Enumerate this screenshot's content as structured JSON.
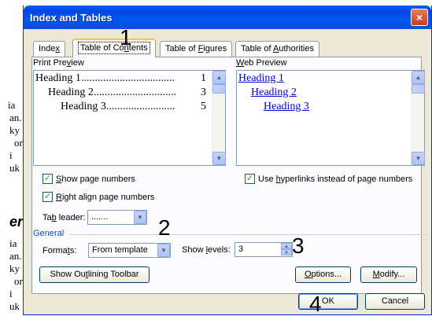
{
  "dialog": {
    "title": "Index and Tables",
    "close_icon": "×"
  },
  "tabs": [
    {
      "pre": "Inde",
      "accel": "x",
      "post": ""
    },
    {
      "pre": "Table of Co",
      "accel": "n",
      "post": "tents"
    },
    {
      "pre": "Table of ",
      "accel": "F",
      "post": "igures"
    },
    {
      "pre": "Table of ",
      "accel": "A",
      "post": "uthorities"
    }
  ],
  "print_preview": {
    "label_pre": "Print Pre",
    "label_accel": "v",
    "label_post": "iew",
    "lines": [
      {
        "text": "Heading 1",
        "dots": "..................................",
        "page": "1"
      },
      {
        "text": "Heading 2",
        "dots": "..............................",
        "page": "3"
      },
      {
        "text": "Heading 3",
        "dots": ".........................",
        "page": "5"
      }
    ]
  },
  "web_preview": {
    "label_pre": "",
    "label_accel": "W",
    "label_post": "eb Preview",
    "links": [
      "Heading 1",
      "Heading 2",
      "Heading 3"
    ]
  },
  "options": {
    "show_page_numbers": {
      "pre": "",
      "accel": "S",
      "post": "how page numbers",
      "checked": true
    },
    "right_align": {
      "pre": "",
      "accel": "R",
      "post": "ight align page numbers",
      "checked": true
    },
    "use_hyperlinks": {
      "pre": "Use ",
      "accel": "h",
      "post": "yperlinks instead of page numbers",
      "checked": true
    },
    "tab_leader": {
      "pre": "Ta",
      "accel": "b",
      "post": " leader:",
      "value": "......."
    }
  },
  "general": {
    "title": "General",
    "formats": {
      "pre": "Forma",
      "accel": "t",
      "post": "s:",
      "value": "From template"
    },
    "show_levels": {
      "pre": "Show ",
      "accel": "l",
      "post": "evels:",
      "value": "3"
    }
  },
  "buttons": {
    "outlining": {
      "pre": "Show Ou",
      "accel": "t",
      "post": "lining Toolbar"
    },
    "options": {
      "pre": "",
      "accel": "O",
      "post": "ptions..."
    },
    "modify": {
      "pre": "",
      "accel": "M",
      "post": "odify..."
    },
    "ok": "OK",
    "cancel": "Cancel"
  },
  "annotations": [
    "1",
    "2",
    "3",
    "4"
  ],
  "background": {
    "fragments_top": [
      "ia",
      "an.",
      "ky",
      "or",
      "i",
      "uk"
    ],
    "heading": "er",
    "fragments_bottom": [
      "ia",
      "an.",
      "ky",
      "or",
      "i",
      "uk"
    ]
  }
}
